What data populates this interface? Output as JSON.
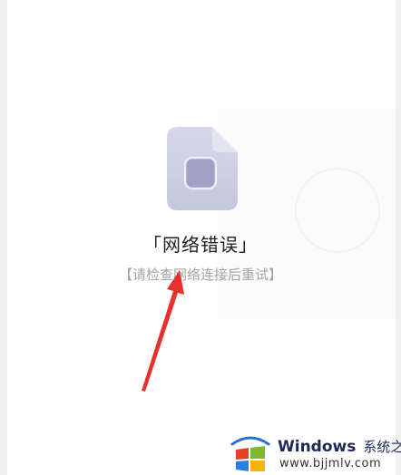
{
  "error": {
    "title": "「网络错误」",
    "subtitle": "【请检查网络连接后重试】"
  },
  "icons": {
    "file": "file-error-icon",
    "arrow": "red-arrow-annotation",
    "logo": "windows-logo-icon"
  },
  "watermark": {
    "brand": "Windows",
    "brand_cn": "系统之家",
    "url": "www.bjjmlv.com"
  },
  "colors": {
    "file_icon": "#c9cbe0",
    "file_inner": "#9ea1c3",
    "arrow": "#e8312f"
  }
}
